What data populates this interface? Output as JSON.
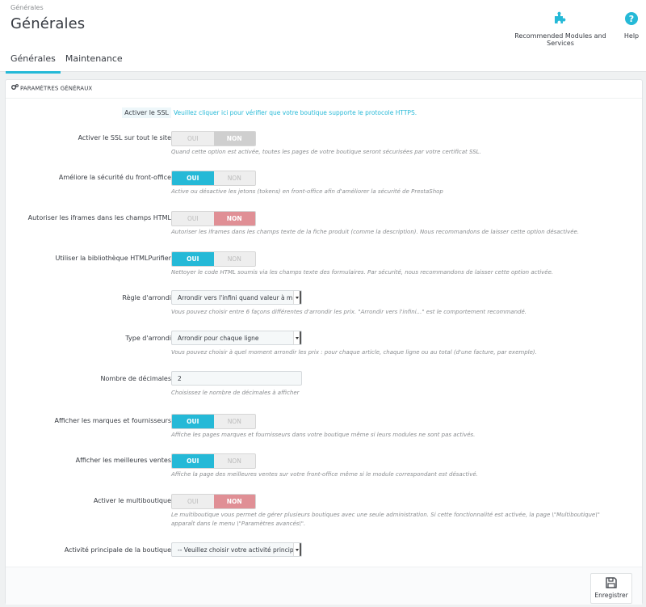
{
  "header": {
    "breadcrumb": "Générales",
    "title": "Générales",
    "toolbar": [
      {
        "label": "Recommended Modules and Services",
        "icon": "puzzle-icon"
      },
      {
        "label": "Help",
        "icon": "help-circle-icon"
      }
    ]
  },
  "tabs": [
    {
      "label": "Générales",
      "active": true
    },
    {
      "label": "Maintenance",
      "active": false
    }
  ],
  "panel": {
    "heading": "PARAMÈTRES GÉNÉRAUX",
    "ssl": {
      "label": "Activer le SSL",
      "link": "Veuillez cliquer ici pour vérifier que votre boutique supporte le protocole HTTPS."
    },
    "fields": [
      {
        "label": "Activer le SSL sur tout le site",
        "type": "switch",
        "value": "NON",
        "on_label": "OUI",
        "off_label": "NON",
        "help": "Quand cette option est activée, toutes les pages de votre boutique seront sécurisées par votre certificat SSL."
      },
      {
        "label": "Améliore la sécurité du front-office",
        "type": "switch",
        "value": "OUI",
        "on_label": "OUI",
        "off_label": "NON",
        "help": "Active ou désactive les jetons (tokens) en front-office afin d'améliorer la sécurité de PrestaShop"
      },
      {
        "label": "Autoriser les iframes dans les champs HTML",
        "type": "switch",
        "value": "NON",
        "on_label": "OUI",
        "off_label": "NON",
        "help": "Autoriser les iframes dans les champs texte de la fiche produit (comme la description). Nous recommandons de laisser cette option désactivée."
      },
      {
        "label": "Utiliser la bibliothèque HTMLPurifier",
        "type": "switch",
        "value": "OUI",
        "on_label": "OUI",
        "off_label": "NON",
        "help": "Nettoyer le code HTML soumis via les champs texte des formulaires. Par sécurité, nous recommandons de laisser cette option activée."
      },
      {
        "label": "Règle d'arrondi",
        "type": "select",
        "value": "Arrondir vers l'infini quand valeur à m",
        "help": "Vous pouvez choisir entre 6 façons différentes d'arrondir les prix. \"Arrondir vers l'infini...\" est le comportement recommandé."
      },
      {
        "label": "Type d'arrondi",
        "type": "select",
        "value": "Arrondir pour chaque ligne",
        "help": "Vous pouvez choisir à quel moment arrondir les prix : pour chaque article, chaque ligne ou au total (d'une facture, par exemple)."
      },
      {
        "label": "Nombre de décimales",
        "type": "input",
        "value": "2",
        "help": "Choisissez le nombre de décimales à afficher"
      },
      {
        "label": "Afficher les marques et fournisseurs",
        "type": "switch",
        "value": "OUI",
        "on_label": "OUI",
        "off_label": "NON",
        "help": "Affiche les pages marques et fournisseurs dans votre boutique même si leurs modules ne sont pas activés."
      },
      {
        "label": "Afficher les meilleures ventes",
        "type": "switch",
        "value": "OUI",
        "on_label": "OUI",
        "off_label": "NON",
        "help": "Affiche la page des meilleures ventes sur votre front-office même si le module correspondant est désactivé."
      },
      {
        "label": "Activer le multiboutique",
        "type": "switch",
        "value": "NON",
        "on_label": "OUI",
        "off_label": "NON",
        "help": "Le multiboutique vous permet de gérer plusieurs boutiques avec une seule administration. Si cette fonctionnalité est activée, la page \\\"Multiboutique\\\"",
        "help2": "apparaît dans le menu \\\"Paramètres avancés\\\"."
      },
      {
        "label": "Activité principale de la boutique",
        "type": "select",
        "value": "-- Veuillez choisir votre activité principa"
      }
    ],
    "save_label": "Enregistrer"
  },
  "colors": {
    "accent": "#25b9d7",
    "danger": "#e08f95",
    "neutral_active": "#cfcfcf"
  }
}
